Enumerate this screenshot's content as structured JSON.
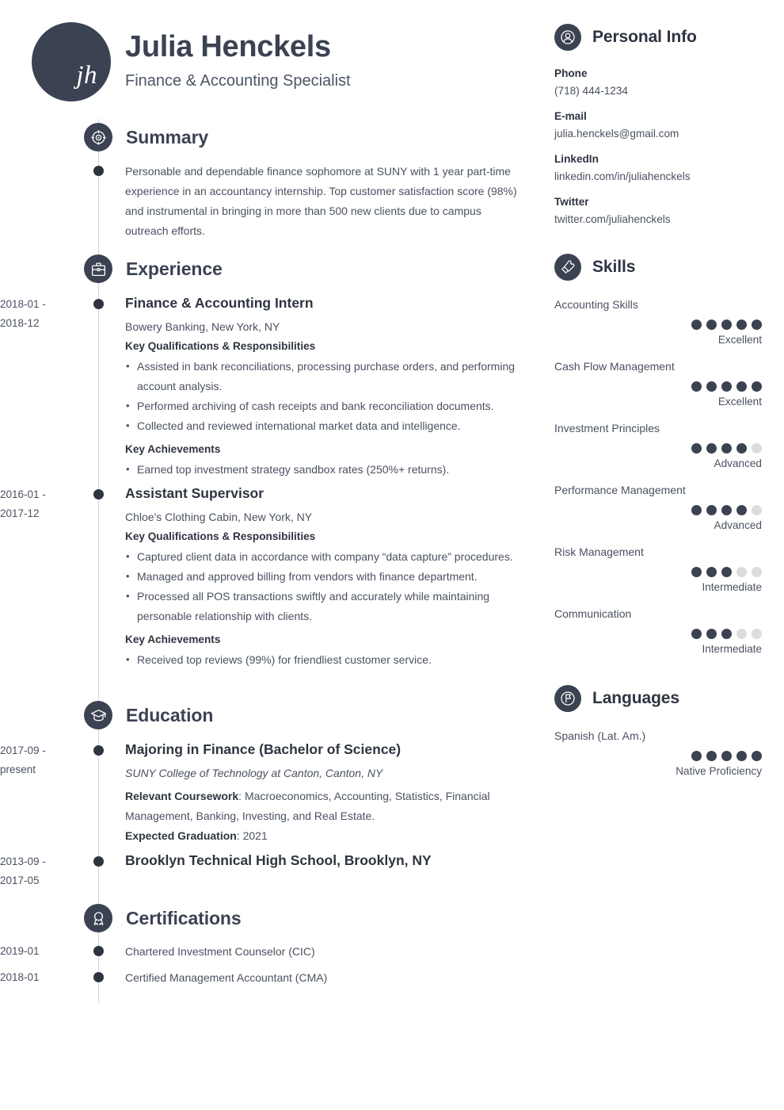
{
  "theme": {
    "dark": "#3b4252",
    "darker": "#2e3440",
    "body_text": "#4a5160",
    "rail": "#cfd2d6",
    "dot_off": "#dcdcdc"
  },
  "header": {
    "initials": "jh",
    "name": "Julia Henckels",
    "job_title": "Finance & Accounting Specialist"
  },
  "summary": {
    "title": "Summary",
    "icon": "target-icon",
    "text": "Personable and dependable finance sophomore at SUNY with 1 year part-time experience in an accountancy internship. Top customer satisfaction score (98%) and instrumental in bringing in more than 500 new clients due to campus outreach efforts."
  },
  "experience": {
    "title": "Experience",
    "icon": "briefcase-icon",
    "entries": [
      {
        "date_line1": "2018-01 -",
        "date_line2": "2018-12",
        "title": "Finance & Accounting Intern",
        "org": "Bowery Banking, New York, NY",
        "qual_heading": "Key Qualifications & Responsibilities",
        "qualifications": [
          "Assisted in bank reconciliations, processing purchase orders, and performing account analysis.",
          "Performed archiving of cash receipts and bank reconciliation documents.",
          "Collected and reviewed international market data and intelligence."
        ],
        "ach_heading": "Key Achievements",
        "achievements": [
          "Earned top investment strategy sandbox rates (250%+ returns)."
        ]
      },
      {
        "date_line1": "2016-01 -",
        "date_line2": "2017-12",
        "title": "Assistant Supervisor",
        "org": "Chloe's Clothing Cabin, New York, NY",
        "qual_heading": "Key Qualifications & Responsibilities",
        "qualifications": [
          "Captured client data in accordance with company “data capture” procedures.",
          "Managed and approved billing from vendors with finance department.",
          "Processed all POS transactions swiftly and accurately while maintaining personable relationship with clients."
        ],
        "ach_heading": "Key Achievements",
        "achievements": [
          "Received top reviews (99%) for friendliest customer service."
        ]
      }
    ]
  },
  "education": {
    "title": "Education",
    "icon": "graduation-cap-icon",
    "entries": [
      {
        "date_line1": "2017-09 -",
        "date_line2": "present",
        "title": "Majoring in Finance (Bachelor of Science)",
        "school": "SUNY College of Technology at Canton, Canton, NY",
        "coursework_label": "Relevant Coursework",
        "coursework_value": ": Macroeconomics, Accounting, Statistics, Financial Management, Banking, Investing, and Real Estate.",
        "graduation_label": "Expected Graduation",
        "graduation_value": ": 2021"
      },
      {
        "date_line1": "2013-09 -",
        "date_line2": "2017-05",
        "title": "Brooklyn Technical High School, Brooklyn, NY",
        "school": "",
        "coursework_label": "",
        "coursework_value": "",
        "graduation_label": "",
        "graduation_value": ""
      }
    ]
  },
  "certifications": {
    "title": "Certifications",
    "icon": "award-ribbon-icon",
    "entries": [
      {
        "date": "2019-01",
        "name": "Chartered Investment Counselor (CIC)"
      },
      {
        "date": "2018-01",
        "name": "Certified Management Accountant (CMA)"
      }
    ]
  },
  "personal_info": {
    "title": "Personal Info",
    "icon": "person-icon",
    "items": [
      {
        "label": "Phone",
        "value": "(718) 444-1234"
      },
      {
        "label": "E-mail",
        "value": "julia.henckels@gmail.com"
      },
      {
        "label": "LinkedIn",
        "value": "linkedin.com/in/juliahenckels"
      },
      {
        "label": "Twitter",
        "value": "twitter.com/juliahenckels"
      }
    ]
  },
  "skills": {
    "title": "Skills",
    "icon": "puzzle-piece-icon",
    "max_rating": 5,
    "items": [
      {
        "name": "Accounting Skills",
        "rating": 5,
        "level": "Excellent"
      },
      {
        "name": "Cash Flow Management",
        "rating": 5,
        "level": "Excellent"
      },
      {
        "name": "Investment Principles",
        "rating": 4,
        "level": "Advanced"
      },
      {
        "name": "Performance Management",
        "rating": 4,
        "level": "Advanced"
      },
      {
        "name": "Risk Management",
        "rating": 3,
        "level": "Intermediate"
      },
      {
        "name": "Communication",
        "rating": 3,
        "level": "Intermediate"
      }
    ]
  },
  "languages": {
    "title": "Languages",
    "icon": "flag-icon",
    "max_rating": 5,
    "items": [
      {
        "name": "Spanish (Lat. Am.)",
        "rating": 5,
        "level": "Native Proficiency"
      }
    ]
  }
}
